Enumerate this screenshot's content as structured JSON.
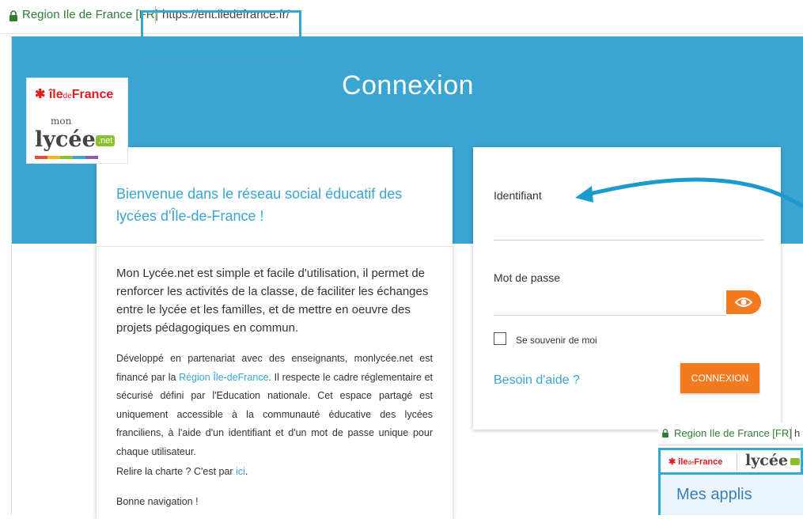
{
  "address_bar": {
    "site_identity": "Region Ile de France [FR]",
    "url": "https://ent.iledefrance.fr/"
  },
  "logo": {
    "region_prefix": "île",
    "region_de": "de",
    "region_suffix": "France",
    "mon": "mon",
    "lycee": "lycée",
    "net": ".net"
  },
  "banner": {
    "title": "Connexion"
  },
  "welcome": {
    "heading": "Bienvenue dans le réseau social éducatif des lycées d'Île-de-France !",
    "intro": "Mon Lycée.net est simple et facile d'utilisation, il permet de renforcer les activités de la classe, de faciliter les échanges entre le lycée et les familles, et de mettre en oeuvre des projets pédagogiques en commun.",
    "partner_before": "Développé en partenariat avec des enseignants, monlycée.net est financé par la ",
    "partner_link": "Région Île-deFrance",
    "partner_after": ". Il respecte le cadre réglementaire et sécurisé défini par l'Education nationale. Cet espace partagé est uniquement accessible à la communauté éducative des lycées franciliens, à l'aide d'un identifiant et d'un mot de passe unique pour chaque utilisateur.",
    "charter_before": "Relire la charte ? C'est par ",
    "charter_link": "ici",
    "charter_after": ".",
    "closing": "Bonne navigation !"
  },
  "login": {
    "identifier_label": "Identifiant",
    "password_label": "Mot de passe",
    "remember_label": "Se souvenir de moi",
    "help_link": "Besoin d'aide ?",
    "submit_label": "CONNEXION"
  },
  "inset": {
    "site_identity": "Region Ile de France [FR]",
    "url_fragment": "h",
    "region_prefix": "île",
    "region_de": "de",
    "region_suffix": "France",
    "lycee": "lycée",
    "apps_title": "Mes applis"
  },
  "colors": {
    "brand_blue": "#3aa5d2",
    "accent_orange": "#f47a20",
    "region_red": "#e21b23",
    "secure_green": "#2f7d32"
  }
}
